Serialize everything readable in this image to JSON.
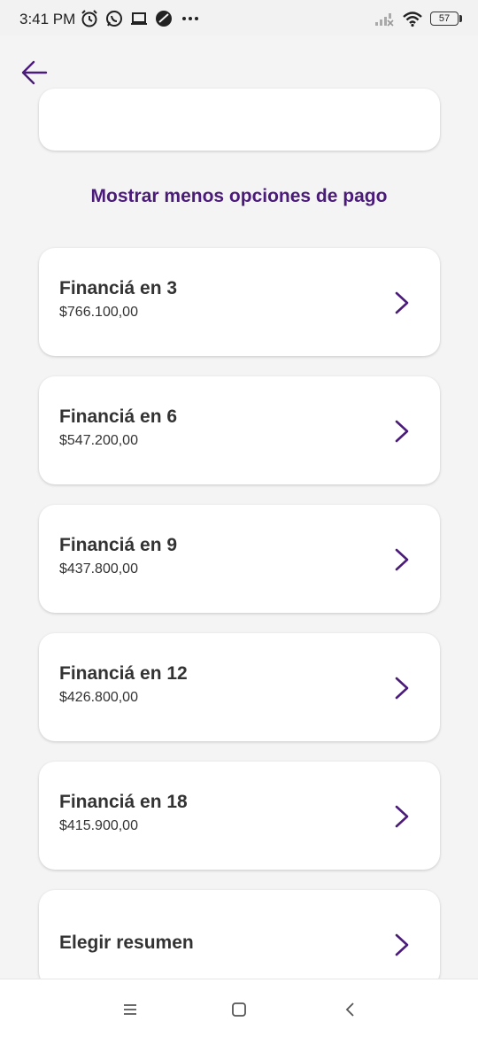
{
  "status_bar": {
    "time": "3:41 PM",
    "battery": "57",
    "icons_left": [
      "alarm-icon",
      "whatsapp-icon",
      "laptop-icon",
      "app-icon",
      "more-dots-icon"
    ],
    "icons_right": [
      "signal-off-icon",
      "wifi-icon",
      "battery-icon"
    ]
  },
  "header": {
    "back_icon": "arrow-left-icon"
  },
  "toggle_link": "Mostrar menos opciones de pago",
  "options": [
    {
      "title": "Financiá en 3",
      "amount": "$766.100,00"
    },
    {
      "title": "Financiá en 6",
      "amount": "$547.200,00"
    },
    {
      "title": "Financiá en 9",
      "amount": "$437.800,00"
    },
    {
      "title": "Financiá en 12",
      "amount": "$426.800,00"
    },
    {
      "title": "Financiá en 18",
      "amount": "$415.900,00"
    }
  ],
  "last_option": {
    "title": "Elegir resumen"
  },
  "colors": {
    "accent": "#4b1b7a",
    "background": "#f4f4f4",
    "card": "#ffffff"
  },
  "nav_bar": [
    "menu-icon",
    "home-icon",
    "back-icon"
  ]
}
